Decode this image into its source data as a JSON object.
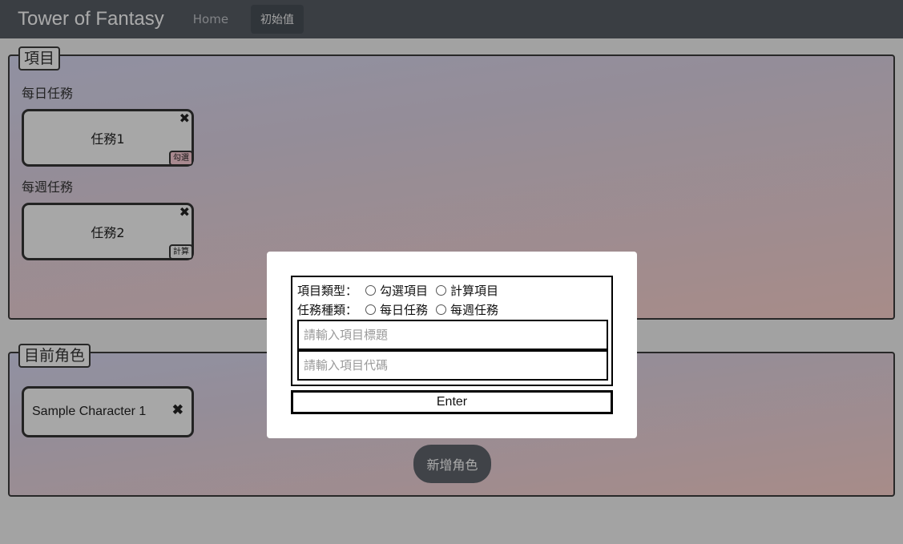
{
  "navbar": {
    "brand": "Tower of Fantasy",
    "links": [
      {
        "label": "Home"
      },
      {
        "label": "初始值"
      }
    ]
  },
  "items_panel": {
    "legend": "項目",
    "daily": {
      "label": "每日任務",
      "card_title": "任務1",
      "card_tag": "勾選"
    },
    "weekly": {
      "label": "每週任務",
      "card_title": "任務2",
      "card_tag": "計算"
    },
    "close_glyph": "✖"
  },
  "characters_panel": {
    "legend": "目前角色",
    "character_name": "Sample Character 1",
    "add_button": "新增角色"
  },
  "modal": {
    "type_label": "項目類型：",
    "type_options": [
      "勾選項目",
      "計算項目"
    ],
    "task_label": "任務種類：",
    "task_options": [
      "每日任務",
      "每週任務"
    ],
    "title_placeholder": "請輸入項目標題",
    "code_placeholder": "請輸入項目代碼",
    "enter_label": "Enter"
  },
  "colors": {
    "navbar": "#535961",
    "tag_check": "#f1c4cd",
    "overlay": "rgba(0,0,0,0.30)"
  }
}
